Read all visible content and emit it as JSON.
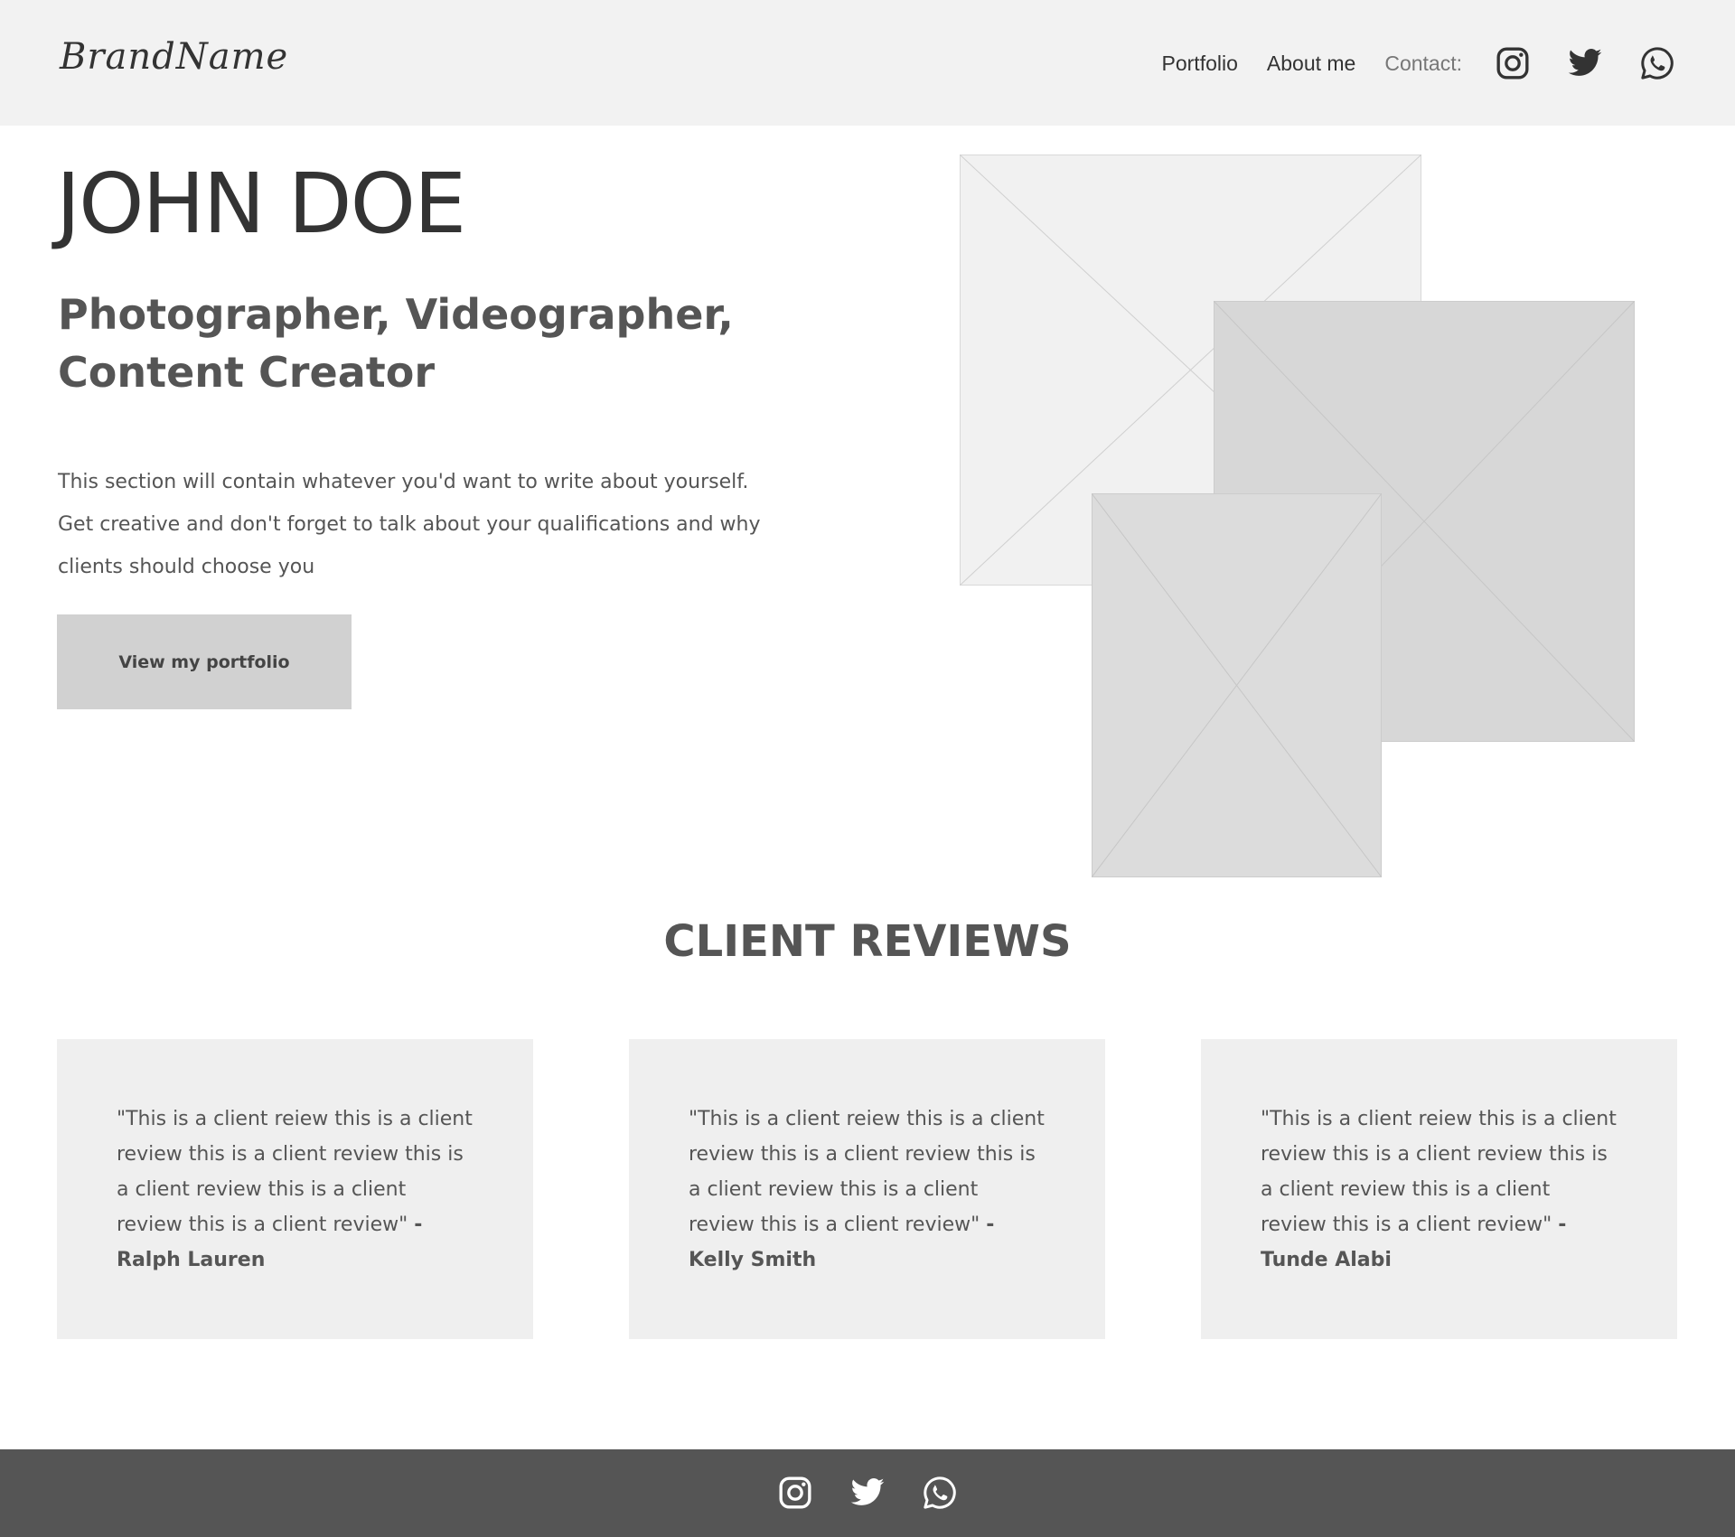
{
  "header": {
    "brand": "BrandName",
    "nav": {
      "portfolio": "Portfolio",
      "about": "About me",
      "contact": "Contact:"
    }
  },
  "hero": {
    "name": "JOHN DOE",
    "subtitle": "Photographer, Videographer, Content Creator",
    "bio": "This section will contain whatever you'd want to write about yourself. Get creative and don't forget to talk about your qualifications and why clients should choose you",
    "cta": "View my portfolio"
  },
  "reviews": {
    "title": "CLIENT REVIEWS",
    "items": [
      {
        "text": "\"This is  a client reiew this is a client review this is a client review this is a client review this is a client review this is a client review\"",
        "author": "- Ralph Lauren"
      },
      {
        "text": "\"This is  a client reiew this is a client review this is a client review this is a client review this is a client review this is a client review\"",
        "author": "- Kelly Smith"
      },
      {
        "text": "\"This is  a client reiew this is a client review this is a client review this is a client review this is a client review this is a client review\"",
        "author": "- Tunde Alabi"
      }
    ]
  },
  "icons": [
    "instagram-icon",
    "twitter-icon",
    "whatsapp-icon"
  ],
  "colors": {
    "header_bg": "#f2f2f2",
    "footer_bg": "#555555",
    "text": "#555555",
    "button_bg": "#d1d1d1",
    "card_bg": "#efefef"
  }
}
